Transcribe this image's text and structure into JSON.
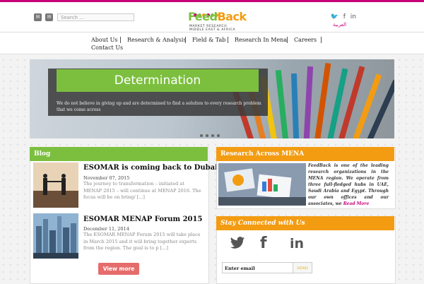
{
  "colors": {
    "brand_pink": "#c8007a",
    "green": "#7cbf3f",
    "orange": "#f39c12",
    "view_more": "#e66c6c"
  },
  "header": {
    "icons": [
      "mail-icon",
      "envelope-icon"
    ],
    "search_placeholder": "Search ...",
    "logo": {
      "brand": "FeedBack",
      "brand_part1": "Feed",
      "brand_part2": "Back",
      "sub_line1": "MARKET RESEARCH",
      "sub_line2": "MIDDLE EAST & AFRICA"
    },
    "social": {
      "twitter": "𝕥",
      "facebook": "f",
      "linkedin": "in"
    },
    "language": "العربية"
  },
  "nav": {
    "items": [
      "About Us",
      "Research & Analysis",
      "Field & Tab",
      "Research In Mena",
      "Careers",
      "Contact Us"
    ]
  },
  "slider": {
    "title": "Determination",
    "text": "We do not believe in giving up and are determined to find a solution to every research problem that we come across"
  },
  "blog": {
    "heading": "Blog",
    "posts": [
      {
        "title": "ESOMAR is coming back to Dubai",
        "date": "November 07, 2015",
        "excerpt": "The journey to transformation – initiated at MENAP 2015 – will continue at MENAP 2016. The focus will be on bring/ [...]"
      },
      {
        "title": "ESOMAR MENAP Forum 2015",
        "date": "December 11, 2014",
        "excerpt": "The ESOMAR MENAP Forum 2015 will take place in March 2015 and it will bring together experts from the region. The goal is to p [...]"
      }
    ],
    "view_more": "View more"
  },
  "mena": {
    "heading": "Research Across MENA",
    "text": "FeedBack is one of the leading research organizations in the MENA region. We operate from three full-fledged hubs in UAE, Saudi Arabia and Egypt. Through our own offices and our associates, we",
    "read_more": "Read More"
  },
  "stay": {
    "heading": "Stay Connected with Us",
    "email_placeholder": "Enter email",
    "send": "SEND"
  }
}
